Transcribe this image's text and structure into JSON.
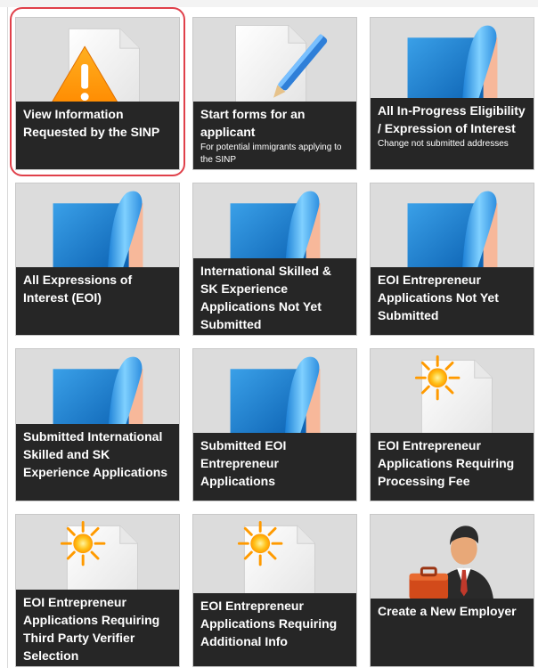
{
  "tiles": [
    {
      "title": "View Information Requested by the SINP",
      "subtitle": "",
      "icon": "warning-document-icon"
    },
    {
      "title": "Start forms for an applicant",
      "subtitle": "For potential immigrants applying to the SINP",
      "icon": "document-pen-icon"
    },
    {
      "title": "All In-Progress Eligibility / Expression of Interest",
      "subtitle": "Change not submitted addresses",
      "icon": "folder-page-curl-icon"
    },
    {
      "title": "All Expressions of Interest (EOI)",
      "subtitle": "",
      "icon": "folder-page-curl-icon"
    },
    {
      "title": "International Skilled & SK Experience Applications Not Yet Submitted",
      "subtitle": "",
      "icon": "folder-page-curl-icon"
    },
    {
      "title": "EOI Entrepreneur Applications Not Yet Submitted",
      "subtitle": "",
      "icon": "folder-page-curl-icon"
    },
    {
      "title": "Submitted International Skilled and SK Experience Applications",
      "subtitle": "",
      "icon": "folder-page-curl-icon"
    },
    {
      "title": "Submitted EOI Entrepreneur Applications",
      "subtitle": "",
      "icon": "folder-page-curl-icon"
    },
    {
      "title": "EOI Entrepreneur Applications Requiring Processing Fee",
      "subtitle": "",
      "icon": "sun-document-icon"
    },
    {
      "title": "EOI Entrepreneur Applications Requiring Third Party Verifier Selection",
      "subtitle": "",
      "icon": "sun-document-icon"
    },
    {
      "title": "EOI Entrepreneur Applications Requiring Additional Info",
      "subtitle": "",
      "icon": "sun-document-icon"
    },
    {
      "title": "Create a New Employer",
      "subtitle": "",
      "icon": "businessman-briefcase-icon"
    }
  ],
  "colors": {
    "tile_bg": "#dcdcdc",
    "caption_bg": "#262626",
    "highlight": "#e0404a"
  }
}
